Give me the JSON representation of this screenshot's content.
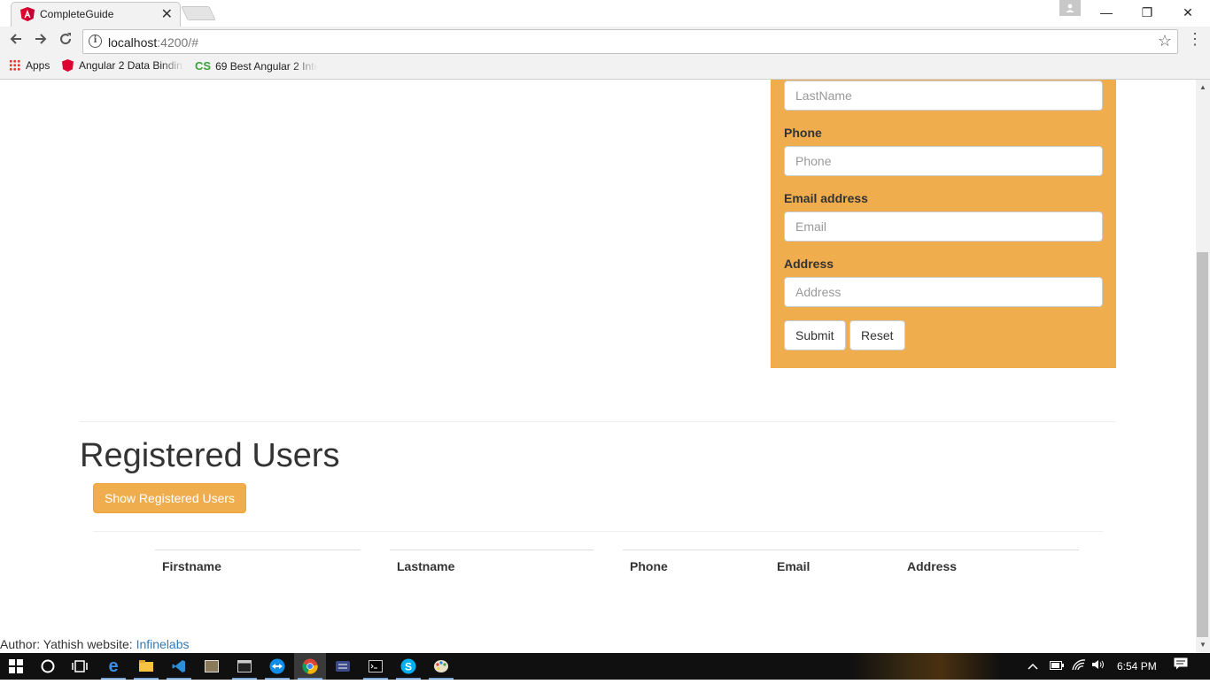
{
  "browser": {
    "tab_title": "CompleteGuide",
    "tab_close": "✕",
    "profile_icon": "person-icon",
    "window_controls": {
      "minimize": "—",
      "maximize": "❐",
      "close": "✕"
    },
    "url_host": "localhost",
    "url_rest": ":4200/#",
    "bookmarks": [
      {
        "label": "Apps",
        "icon": "apps-grid-icon"
      },
      {
        "label": "Angular 2 Data Bindin",
        "icon": "angular-icon"
      },
      {
        "label": "69 Best Angular 2 Inte",
        "icon": "cs-icon"
      }
    ]
  },
  "form": {
    "lastname_placeholder": "LastName",
    "phone_label": "Phone",
    "phone_placeholder": "Phone",
    "email_label": "Email address",
    "email_placeholder": "Email",
    "address_label": "Address",
    "address_placeholder": "Address",
    "submit_label": "Submit",
    "reset_label": "Reset",
    "panel_color": "#f0ad4e"
  },
  "registered": {
    "heading": "Registered Users",
    "show_button": "Show Registered Users",
    "columns": [
      "Firstname",
      "Lastname",
      "Phone",
      "Email",
      "Address"
    ]
  },
  "footer": {
    "author_text": "Author: Yathish website: ",
    "link_text": "Infinelabs",
    "link_color": "#337ab7"
  },
  "taskbar": {
    "time": "6:54 PM",
    "apps": [
      "start-icon",
      "cortana-icon",
      "task-view-icon",
      "edge-icon",
      "file-explorer-icon",
      "vscode-icon",
      "app-icon",
      "terminal-icon",
      "teamviewer-icon",
      "chrome-icon",
      "app-icon",
      "cmd-icon",
      "skype-icon",
      "paint-icon"
    ]
  }
}
